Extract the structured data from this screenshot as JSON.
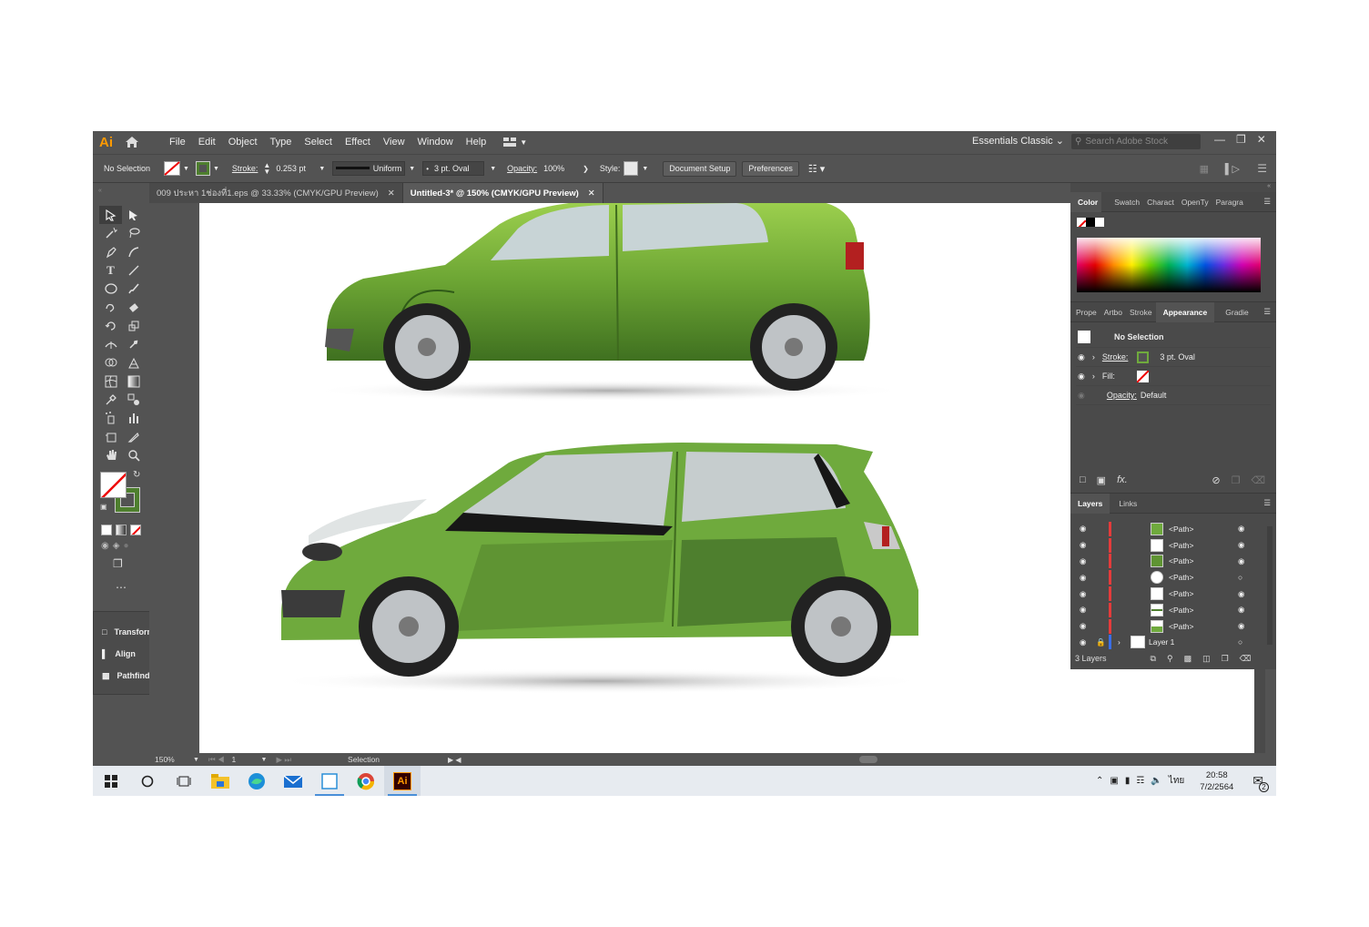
{
  "app": {
    "logo": "Ai",
    "menu": [
      "File",
      "Edit",
      "Object",
      "Type",
      "Select",
      "Effect",
      "View",
      "Window",
      "Help"
    ],
    "workspace": "Essentials Classic",
    "search_placeholder": "Search Adobe Stock"
  },
  "control_bar": {
    "selection": "No Selection",
    "stroke_label": "Stroke:",
    "stroke_value": "0.253 pt",
    "profile": "Uniform",
    "brush": "3 pt. Oval",
    "opacity_label": "Opacity:",
    "opacity_value": "100%",
    "style_label": "Style:",
    "document_setup": "Document Setup",
    "preferences": "Preferences"
  },
  "tabs": [
    {
      "label": "009 ประหา 1ช่องที่1.eps @ 33.33% (CMYK/GPU Preview)",
      "active": false
    },
    {
      "label": "Untitled-3* @ 150% (CMYK/GPU Preview)",
      "active": true
    }
  ],
  "mini_panel": [
    "Transform",
    "Align",
    "Pathfind..."
  ],
  "color_panel": {
    "tabs": [
      "Color",
      "Swatch",
      "Charact",
      "OpenTy",
      "Paragra"
    ]
  },
  "appearance_panel": {
    "tabs": [
      "Prope",
      "Artbo",
      "Stroke",
      "Appearance",
      "Gradie"
    ],
    "title": "No Selection",
    "stroke_label": "Stroke:",
    "stroke_value": "3 pt. Oval",
    "fill_label": "Fill:",
    "opacity_label": "Opacity:",
    "opacity_value": "Default",
    "fx": "fx."
  },
  "layers_panel": {
    "tabs": [
      "Layers",
      "Links"
    ],
    "rows": [
      "<Path>",
      "<Path>",
      "<Path>",
      "<Path>",
      "<Path>",
      "<Path>",
      "<Path>"
    ],
    "layer_name": "Layer 1",
    "count": "3 Layers"
  },
  "status": {
    "zoom": "150%",
    "artboard": "1",
    "tool": "Selection"
  },
  "taskbar": {
    "lang": "ไทย",
    "time": "20:58",
    "date": "7/2/2564",
    "notif_count": "2"
  },
  "colors": {
    "car_green": "#6faa3d",
    "car_dark": "#4e7f2e",
    "panel": "#535353",
    "accent_orange": "#ff9a00"
  }
}
